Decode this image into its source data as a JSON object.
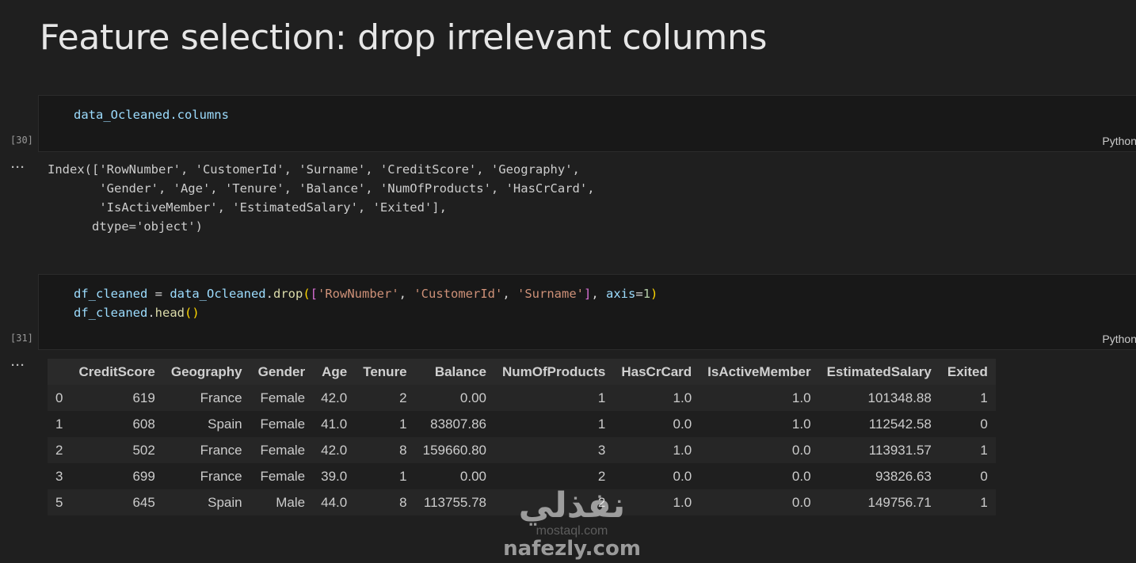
{
  "heading": "Feature selection: drop irrelevant columns",
  "cells": [
    {
      "exec_count": "[30]",
      "language": "Python",
      "code_lines": [
        "data_Ocleaned.columns"
      ]
    },
    {
      "exec_count": "[31]",
      "language": "Python",
      "code_tokens": {
        "line1_var": "df_cleaned",
        "line1_eq": " = ",
        "line1_obj": "data_Ocleaned",
        "line1_dot": ".",
        "line1_fn": "drop",
        "line1_p1": "(",
        "line1_b1": "[",
        "line1_s1": "'RowNumber'",
        "line1_c1": ", ",
        "line1_s2": "'CustomerId'",
        "line1_c2": ", ",
        "line1_s3": "'Surname'",
        "line1_b2": "]",
        "line1_c3": ", ",
        "line1_kw": "axis",
        "line1_eq2": "=",
        "line1_num": "1",
        "line1_p2": ")",
        "line2_var": "df_cleaned",
        "line2_dot": ".",
        "line2_fn": "head",
        "line2_par": "()"
      }
    }
  ],
  "output_menu_label": "···",
  "output_30_lines": [
    "Index(['RowNumber', 'CustomerId', 'Surname', 'CreditScore', 'Geography',",
    "       'Gender', 'Age', 'Tenure', 'Balance', 'NumOfProducts', 'HasCrCard',",
    "       'IsActiveMember', 'EstimatedSalary', 'Exited'],",
    "      dtype='object')"
  ],
  "dataframe": {
    "columns": [
      "",
      "CreditScore",
      "Geography",
      "Gender",
      "Age",
      "Tenure",
      "Balance",
      "NumOfProducts",
      "HasCrCard",
      "IsActiveMember",
      "EstimatedSalary",
      "Exited"
    ],
    "rows": [
      [
        "0",
        "619",
        "France",
        "Female",
        "42.0",
        "2",
        "0.00",
        "1",
        "1.0",
        "1.0",
        "101348.88",
        "1"
      ],
      [
        "1",
        "608",
        "Spain",
        "Female",
        "41.0",
        "1",
        "83807.86",
        "1",
        "0.0",
        "1.0",
        "112542.58",
        "0"
      ],
      [
        "2",
        "502",
        "France",
        "Female",
        "42.0",
        "8",
        "159660.80",
        "3",
        "1.0",
        "0.0",
        "113931.57",
        "1"
      ],
      [
        "3",
        "699",
        "France",
        "Female",
        "39.0",
        "1",
        "0.00",
        "2",
        "0.0",
        "0.0",
        "93826.63",
        "0"
      ],
      [
        "5",
        "645",
        "Spain",
        "Male",
        "44.0",
        "8",
        "113755.78",
        "2",
        "1.0",
        "0.0",
        "149756.71",
        "1"
      ]
    ]
  },
  "watermark": {
    "arabic": "نفذلي",
    "sub": "mostaql.com",
    "latin": "nafezly.com"
  }
}
